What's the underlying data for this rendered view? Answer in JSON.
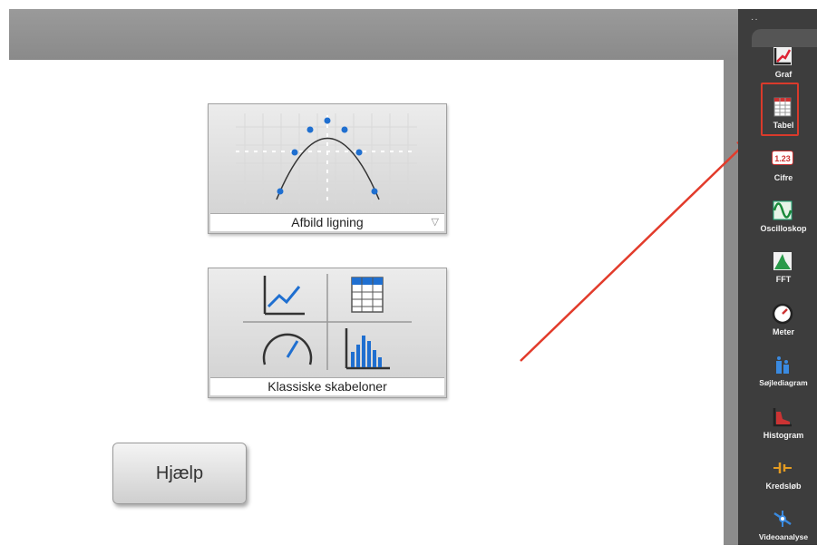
{
  "topbar": {
    "handle_dots": "··"
  },
  "templates": {
    "afbild": {
      "label": "Afbild ligning"
    },
    "klassiske": {
      "label": "Klassiske skabeloner"
    }
  },
  "help_button": {
    "label": "Hjælp"
  },
  "toolbox": {
    "items": [
      {
        "label": "Graf",
        "icon": "graph-icon"
      },
      {
        "label": "Tabel",
        "icon": "table-icon",
        "highlighted": true
      },
      {
        "label": "Cifre",
        "icon": "digits-icon",
        "badge": "1.23"
      },
      {
        "label": "Oscilloskop",
        "icon": "oscilloscope-icon"
      },
      {
        "label": "FFT",
        "icon": "fft-icon"
      },
      {
        "label": "Meter",
        "icon": "meter-icon"
      },
      {
        "label": "Søjlediagram",
        "icon": "bar-chart-icon"
      },
      {
        "label": "Histogram",
        "icon": "histogram-icon"
      },
      {
        "label": "Kredsløb",
        "icon": "circuit-icon"
      },
      {
        "label": "Videoanalyse",
        "icon": "video-analysis-icon"
      }
    ]
  },
  "colors": {
    "highlight": "#d93a2b",
    "arrow": "#e23b2b",
    "panel": "#3d3d3d",
    "accent_blue": "#1f6fd0"
  }
}
